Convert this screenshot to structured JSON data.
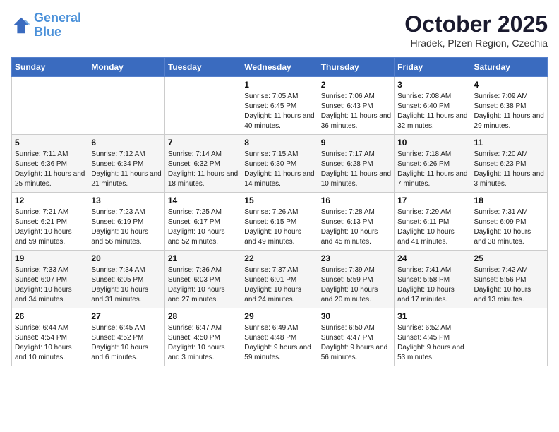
{
  "logo": {
    "line1": "General",
    "line2": "Blue"
  },
  "header": {
    "month": "October 2025",
    "location": "Hradek, Plzen Region, Czechia"
  },
  "days_of_week": [
    "Sunday",
    "Monday",
    "Tuesday",
    "Wednesday",
    "Thursday",
    "Friday",
    "Saturday"
  ],
  "weeks": [
    [
      {
        "day": "",
        "info": ""
      },
      {
        "day": "",
        "info": ""
      },
      {
        "day": "",
        "info": ""
      },
      {
        "day": "1",
        "info": "Sunrise: 7:05 AM\nSunset: 6:45 PM\nDaylight: 11 hours and 40 minutes."
      },
      {
        "day": "2",
        "info": "Sunrise: 7:06 AM\nSunset: 6:43 PM\nDaylight: 11 hours and 36 minutes."
      },
      {
        "day": "3",
        "info": "Sunrise: 7:08 AM\nSunset: 6:40 PM\nDaylight: 11 hours and 32 minutes."
      },
      {
        "day": "4",
        "info": "Sunrise: 7:09 AM\nSunset: 6:38 PM\nDaylight: 11 hours and 29 minutes."
      }
    ],
    [
      {
        "day": "5",
        "info": "Sunrise: 7:11 AM\nSunset: 6:36 PM\nDaylight: 11 hours and 25 minutes."
      },
      {
        "day": "6",
        "info": "Sunrise: 7:12 AM\nSunset: 6:34 PM\nDaylight: 11 hours and 21 minutes."
      },
      {
        "day": "7",
        "info": "Sunrise: 7:14 AM\nSunset: 6:32 PM\nDaylight: 11 hours and 18 minutes."
      },
      {
        "day": "8",
        "info": "Sunrise: 7:15 AM\nSunset: 6:30 PM\nDaylight: 11 hours and 14 minutes."
      },
      {
        "day": "9",
        "info": "Sunrise: 7:17 AM\nSunset: 6:28 PM\nDaylight: 11 hours and 10 minutes."
      },
      {
        "day": "10",
        "info": "Sunrise: 7:18 AM\nSunset: 6:26 PM\nDaylight: 11 hours and 7 minutes."
      },
      {
        "day": "11",
        "info": "Sunrise: 7:20 AM\nSunset: 6:23 PM\nDaylight: 11 hours and 3 minutes."
      }
    ],
    [
      {
        "day": "12",
        "info": "Sunrise: 7:21 AM\nSunset: 6:21 PM\nDaylight: 10 hours and 59 minutes."
      },
      {
        "day": "13",
        "info": "Sunrise: 7:23 AM\nSunset: 6:19 PM\nDaylight: 10 hours and 56 minutes."
      },
      {
        "day": "14",
        "info": "Sunrise: 7:25 AM\nSunset: 6:17 PM\nDaylight: 10 hours and 52 minutes."
      },
      {
        "day": "15",
        "info": "Sunrise: 7:26 AM\nSunset: 6:15 PM\nDaylight: 10 hours and 49 minutes."
      },
      {
        "day": "16",
        "info": "Sunrise: 7:28 AM\nSunset: 6:13 PM\nDaylight: 10 hours and 45 minutes."
      },
      {
        "day": "17",
        "info": "Sunrise: 7:29 AM\nSunset: 6:11 PM\nDaylight: 10 hours and 41 minutes."
      },
      {
        "day": "18",
        "info": "Sunrise: 7:31 AM\nSunset: 6:09 PM\nDaylight: 10 hours and 38 minutes."
      }
    ],
    [
      {
        "day": "19",
        "info": "Sunrise: 7:33 AM\nSunset: 6:07 PM\nDaylight: 10 hours and 34 minutes."
      },
      {
        "day": "20",
        "info": "Sunrise: 7:34 AM\nSunset: 6:05 PM\nDaylight: 10 hours and 31 minutes."
      },
      {
        "day": "21",
        "info": "Sunrise: 7:36 AM\nSunset: 6:03 PM\nDaylight: 10 hours and 27 minutes."
      },
      {
        "day": "22",
        "info": "Sunrise: 7:37 AM\nSunset: 6:01 PM\nDaylight: 10 hours and 24 minutes."
      },
      {
        "day": "23",
        "info": "Sunrise: 7:39 AM\nSunset: 5:59 PM\nDaylight: 10 hours and 20 minutes."
      },
      {
        "day": "24",
        "info": "Sunrise: 7:41 AM\nSunset: 5:58 PM\nDaylight: 10 hours and 17 minutes."
      },
      {
        "day": "25",
        "info": "Sunrise: 7:42 AM\nSunset: 5:56 PM\nDaylight: 10 hours and 13 minutes."
      }
    ],
    [
      {
        "day": "26",
        "info": "Sunrise: 6:44 AM\nSunset: 4:54 PM\nDaylight: 10 hours and 10 minutes."
      },
      {
        "day": "27",
        "info": "Sunrise: 6:45 AM\nSunset: 4:52 PM\nDaylight: 10 hours and 6 minutes."
      },
      {
        "day": "28",
        "info": "Sunrise: 6:47 AM\nSunset: 4:50 PM\nDaylight: 10 hours and 3 minutes."
      },
      {
        "day": "29",
        "info": "Sunrise: 6:49 AM\nSunset: 4:48 PM\nDaylight: 9 hours and 59 minutes."
      },
      {
        "day": "30",
        "info": "Sunrise: 6:50 AM\nSunset: 4:47 PM\nDaylight: 9 hours and 56 minutes."
      },
      {
        "day": "31",
        "info": "Sunrise: 6:52 AM\nSunset: 4:45 PM\nDaylight: 9 hours and 53 minutes."
      },
      {
        "day": "",
        "info": ""
      }
    ]
  ]
}
